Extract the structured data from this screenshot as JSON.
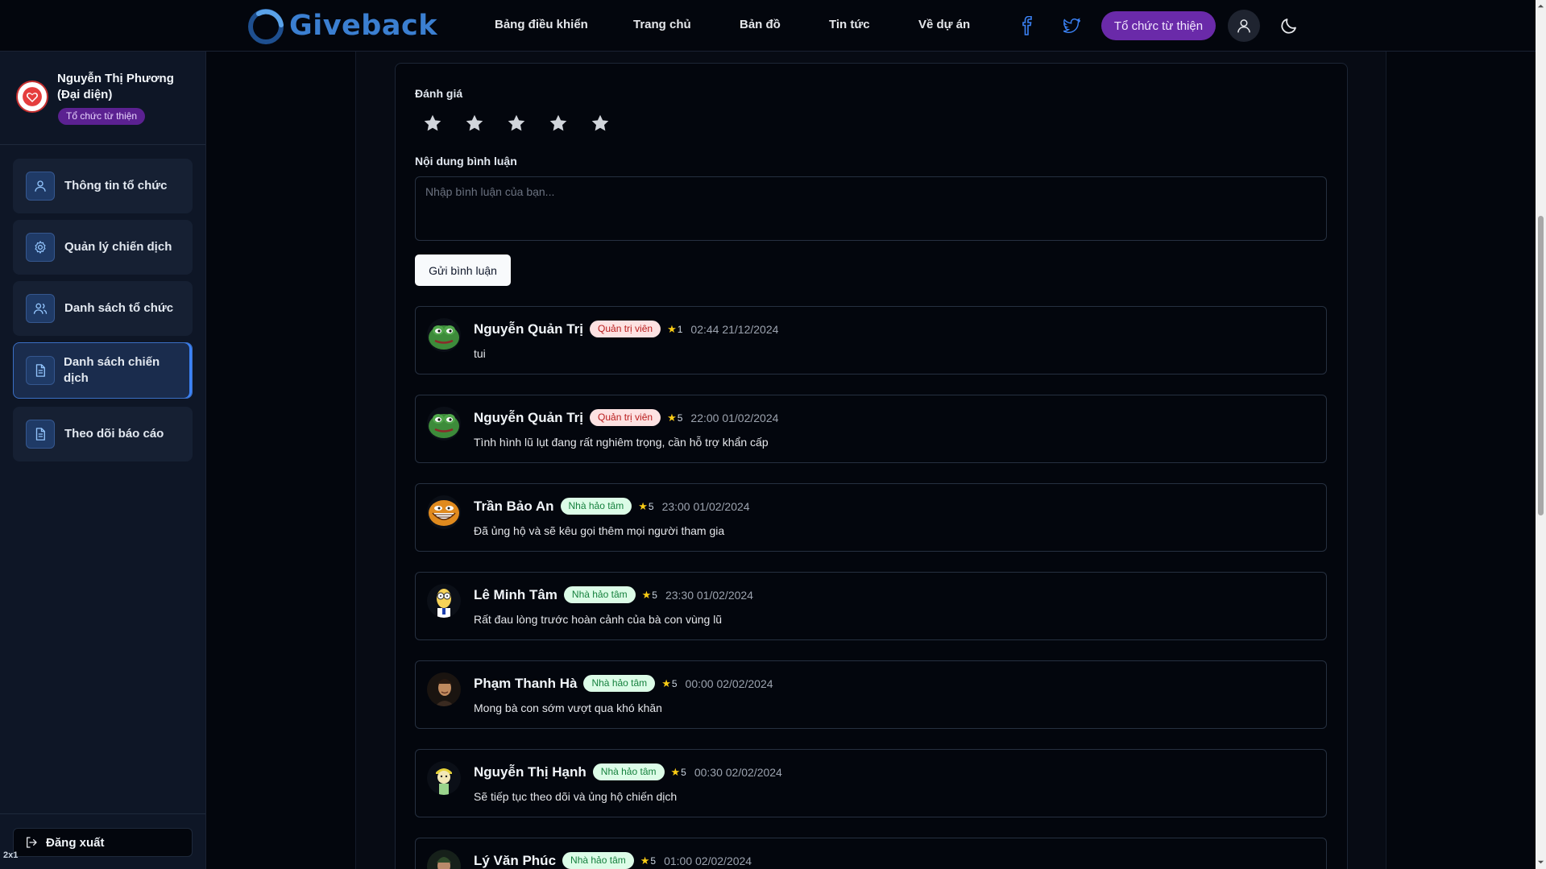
{
  "nav": {
    "brand": "Giveback",
    "links": [
      "Bảng điều khiển",
      "Trang chủ",
      "Bản đồ",
      "Tin tức",
      "Về dự án"
    ],
    "org_button": "Tổ chức từ thiện"
  },
  "sidebar": {
    "profile_name": "Nguyễn Thị Phương (Đại diện)",
    "profile_badge": "Tổ chức từ thiện",
    "items": [
      {
        "label": "Thông tin tổ chức",
        "icon": "user-icon"
      },
      {
        "label": "Quản lý chiến dịch",
        "icon": "gear-icon"
      },
      {
        "label": "Danh sách tổ chức",
        "icon": "users-icon"
      },
      {
        "label": "Danh sách chiến dịch",
        "icon": "document-icon",
        "active": true
      },
      {
        "label": "Theo dõi báo cáo",
        "icon": "document-icon"
      }
    ],
    "logout": "Đăng xuất",
    "zoom": "2x1"
  },
  "form": {
    "rating_label": "Đánh giá",
    "rating_value": 0,
    "rating_max": 5,
    "content_label": "Nội dung bình luận",
    "placeholder": "Nhập bình luận của bạn...",
    "submit": "Gửi bình luận"
  },
  "comments": [
    {
      "name": "Nguyễn Quản Trị",
      "role": "Quản trị viên",
      "role_type": "admin",
      "rating": "1",
      "time": "02:44 21/12/2024",
      "text": "tui",
      "avatar": "frog-avatar"
    },
    {
      "name": "Nguyễn Quản Trị",
      "role": "Quản trị viên",
      "role_type": "admin",
      "rating": "5",
      "time": "22:00 01/02/2024",
      "text": "Tình hình lũ lụt đang rất nghiêm trọng, cần hỗ trợ khẩn cấp",
      "avatar": "frog-avatar"
    },
    {
      "name": "Trần Bảo An",
      "role": "Nhà hảo tâm",
      "role_type": "donor",
      "rating": "5",
      "time": "23:00 01/02/2024",
      "text": "Đã ủng hộ và sẽ kêu gọi thêm mọi người tham gia",
      "avatar": "trollface-avatar"
    },
    {
      "name": "Lê Minh Tâm",
      "role": "Nhà hảo tâm",
      "role_type": "donor",
      "rating": "5",
      "time": "23:30 01/02/2024",
      "text": "Rất đau lòng trước hoàn cảnh của bà con vùng lũ",
      "avatar": "cartoon-avatar"
    },
    {
      "name": "Phạm Thanh Hà",
      "role": "Nhà hảo tâm",
      "role_type": "donor",
      "rating": "5",
      "time": "00:00 02/02/2024",
      "text": "Mong bà con sớm vượt qua khó khăn",
      "avatar": "portrait-avatar"
    },
    {
      "name": "Nguyễn Thị Hạnh",
      "role": "Nhà hảo tâm",
      "role_type": "donor",
      "rating": "5",
      "time": "00:30 02/02/2024",
      "text": "Sẽ tiếp tục theo dõi và ủng hộ chiến dịch",
      "avatar": "cartoon-avatar"
    },
    {
      "name": "Lý Văn Phúc",
      "role": "Nhà hảo tâm",
      "role_type": "donor",
      "rating": "5",
      "time": "01:00 02/02/2024",
      "text": "",
      "avatar": "portrait-avatar"
    }
  ],
  "colors": {
    "brand": "#3b7fd1",
    "org_button": "#6a2aa9",
    "admin_badge_bg": "#fde2e2",
    "donor_badge_bg": "#dcfce7",
    "star": "#facc15"
  }
}
